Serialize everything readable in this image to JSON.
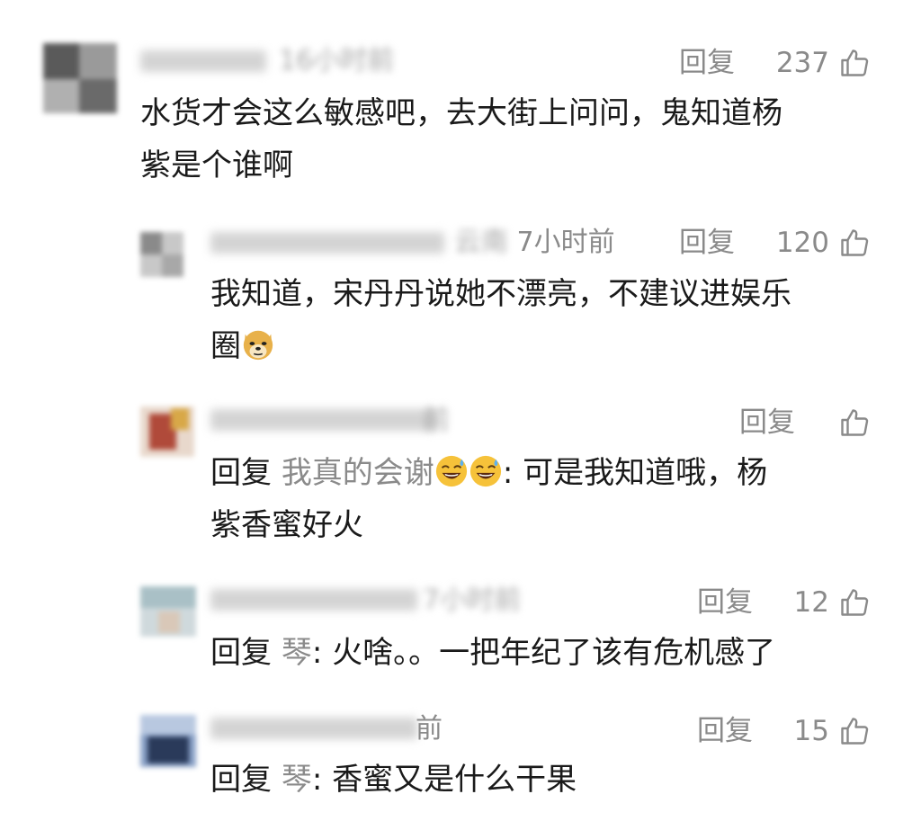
{
  "comments": [
    {
      "time": "16小时前",
      "reply_label": "回复",
      "likes": "237",
      "text_lines": [
        "水货才会这么敏感吧，去大街上问问，鬼知道杨",
        "紫是个谁啊"
      ]
    },
    {
      "location": "云南",
      "time": "7小时前",
      "reply_label": "回复",
      "likes": "120",
      "text_lines": [
        "我知道，宋丹丹说她不漂亮，不建议进娱乐",
        "圈"
      ],
      "emoji": "doge-emoji"
    },
    {
      "time": "前",
      "reply_label": "回复",
      "likes": "",
      "prefix": "回复",
      "reply_to": "我真的会谢",
      "text_after": ": 可是我知道哦，杨",
      "text_line2": "紫香蜜好火",
      "emoji": "sweat-smile-emoji"
    },
    {
      "time": "7小时前",
      "reply_label": "回复",
      "likes": "12",
      "prefix": "回复",
      "reply_to": "琴",
      "text_after": ": 火啥。。一把年纪了该有危机感了"
    },
    {
      "time": "前",
      "reply_label": "回复",
      "likes": "15",
      "prefix": "回复",
      "reply_to": "琴",
      "text_after": ": 香蜜又是什么干果"
    }
  ],
  "colors": {
    "text": "#1a1a1a",
    "meta": "#8a8a8a",
    "background": "#ffffff"
  },
  "icons": {
    "like": "thumbs-up-icon"
  }
}
